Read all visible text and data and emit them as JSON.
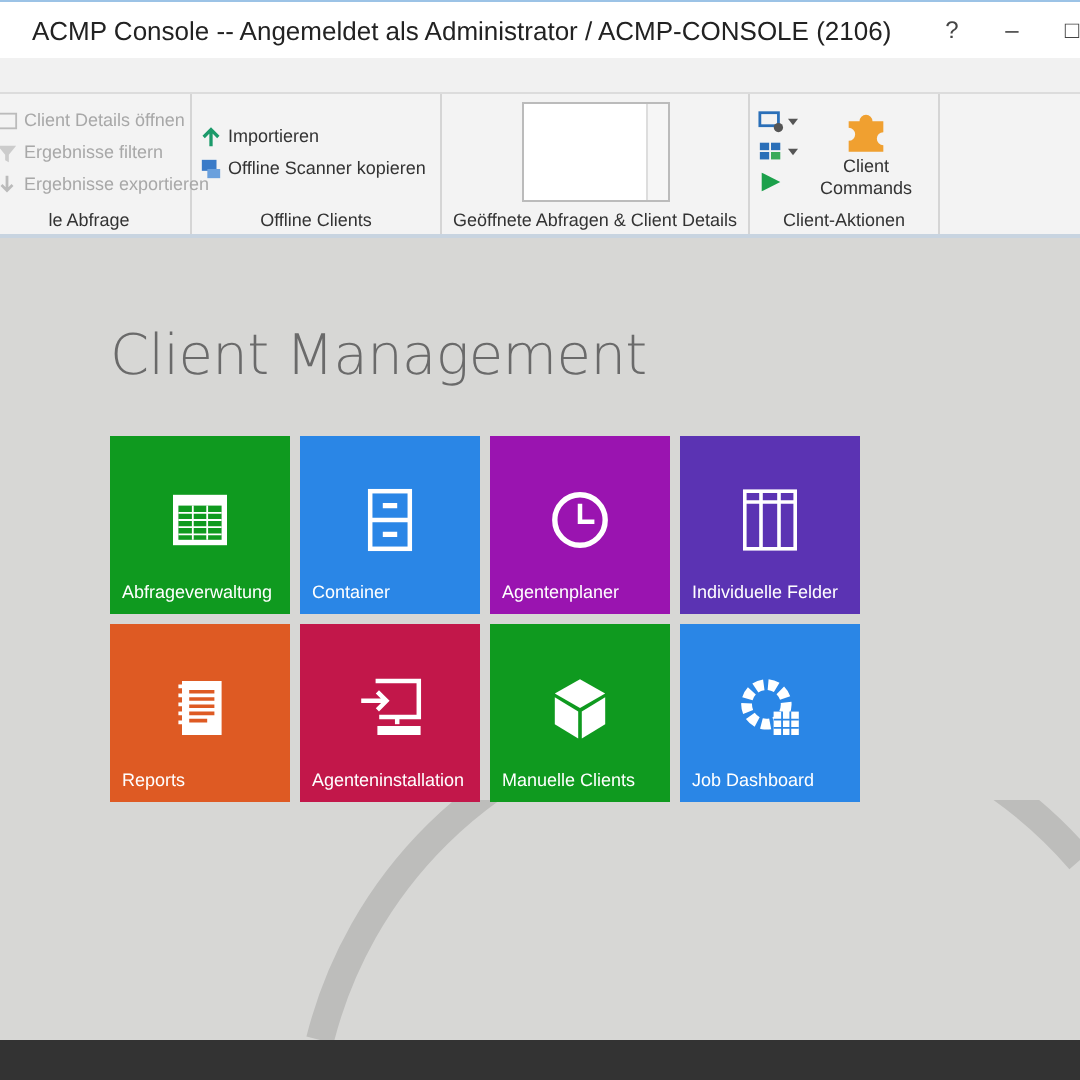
{
  "window": {
    "title": "ACMP Console -- Angemeldet als Administrator / ACMP-CONSOLE (2106)",
    "buttons": [
      "?",
      "–",
      "□"
    ]
  },
  "ribbon": {
    "groups": [
      {
        "label": "le Abfrage",
        "items": [
          {
            "label": "Client Details öffnen",
            "disabled": true
          },
          {
            "label": "Ergebnisse filtern",
            "disabled": true
          },
          {
            "label": "Ergebnisse exportieren",
            "disabled": true
          }
        ]
      },
      {
        "label": "Offline Clients",
        "items": [
          {
            "label": "Importieren",
            "disabled": false
          },
          {
            "label": "Offline Scanner kopieren",
            "disabled": false
          }
        ]
      },
      {
        "label": "Geöffnete Abfragen & Client Details"
      },
      {
        "label": "Client-Aktionen",
        "big_button": "Client Commands"
      }
    ]
  },
  "page": {
    "title": "Client Management",
    "tiles": [
      {
        "label": "Abfrageverwaltung",
        "color": "#0f9a1f"
      },
      {
        "label": "Container",
        "color": "#2a86e6"
      },
      {
        "label": "Agentenplaner",
        "color": "#9a14b0"
      },
      {
        "label": "Individuelle Felder",
        "color": "#5b33b3"
      },
      {
        "label": "Reports",
        "color": "#de5a23"
      },
      {
        "label": "Agenteninstallation",
        "color": "#c2174a"
      },
      {
        "label": "Manuelle Clients",
        "color": "#0f9a1f"
      },
      {
        "label": "Job Dashboard",
        "color": "#2a86e6"
      }
    ]
  }
}
